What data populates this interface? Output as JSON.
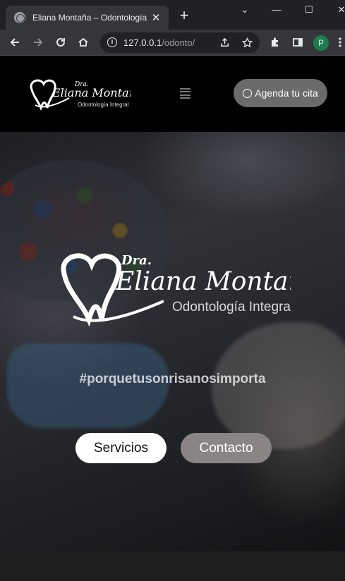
{
  "browser": {
    "tab_title": "Eliana Montaña – Odontología",
    "tab_close": "✕",
    "new_tab": "+",
    "window_controls": {
      "minimize": "—",
      "maximize": "☐",
      "close": "✕",
      "dropdown": "⌄"
    },
    "url_host": "127.0.0.1",
    "url_path": "/odonto/",
    "profile_initial": "P",
    "icons": [
      "back-icon",
      "forward-icon",
      "reload-icon",
      "home-icon",
      "info-icon",
      "share-icon",
      "star-icon",
      "extensions-icon",
      "sidepanel-icon",
      "menu-dots-icon"
    ]
  },
  "header": {
    "logo": {
      "prefix": "Dra.",
      "name": "Eliana Montaña",
      "tagline": "Odontología Integral"
    },
    "cta_label": "Agenda tu cita",
    "cta_icon": "whatsapp-icon"
  },
  "hero": {
    "logo": {
      "prefix": "Dra.",
      "name": "Eliana Montaña",
      "tagline": "Odontología Integral"
    },
    "hashtag": "#porquetusonrisanosimporta",
    "buttons": {
      "services": "Servicios",
      "contact": "Contacto"
    }
  },
  "colors": {
    "header_bg": "#000000",
    "cta_bg": "#6b6b6b",
    "contact_btn": "#8a8584",
    "services_btn": "#ffffff"
  }
}
